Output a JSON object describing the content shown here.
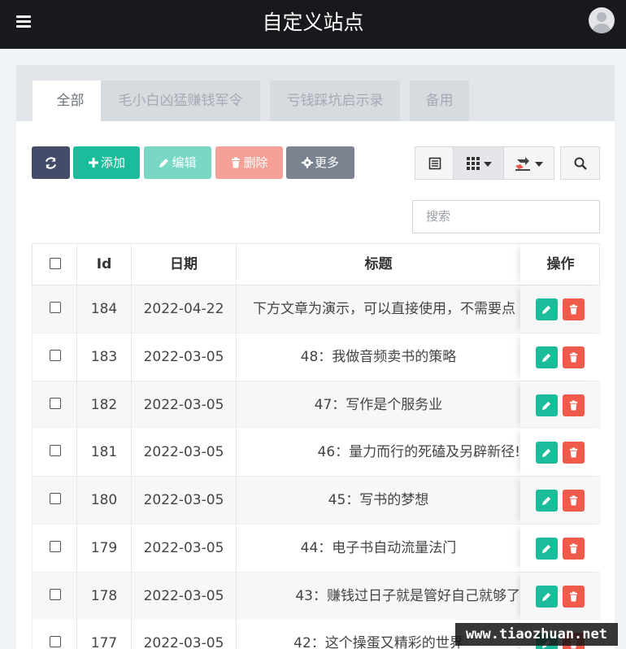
{
  "app": {
    "title": "自定义站点"
  },
  "tabs": [
    {
      "label": "全部",
      "active": true
    },
    {
      "label": "毛小白凶猛赚钱军令",
      "active": false
    },
    {
      "label": "亏钱踩坑启示录",
      "active": false
    },
    {
      "label": "备用",
      "active": false
    }
  ],
  "toolbar": {
    "add_label": "添加",
    "edit_label": "编辑",
    "delete_label": "删除",
    "more_label": "更多"
  },
  "search": {
    "placeholder": "搜索"
  },
  "table": {
    "columns": [
      "Id",
      "日期",
      "标题",
      "操作"
    ],
    "rows": [
      {
        "id": "184",
        "date": "2022-04-22",
        "title": "下方文章为演示，可以直接使用，不需要点"
      },
      {
        "id": "183",
        "date": "2022-03-05",
        "title": "48：我做音频卖书的策略"
      },
      {
        "id": "182",
        "date": "2022-03-05",
        "title": "47：写作是个服务业"
      },
      {
        "id": "181",
        "date": "2022-03-05",
        "title": "46：量力而行的死磕及另辟新径!"
      },
      {
        "id": "180",
        "date": "2022-03-05",
        "title": "45：写书的梦想"
      },
      {
        "id": "179",
        "date": "2022-03-05",
        "title": "44：电子书自动流量法门"
      },
      {
        "id": "178",
        "date": "2022-03-05",
        "title": "43：赚钱过日子就是管好自己就够了"
      },
      {
        "id": "177",
        "date": "2022-03-05",
        "title": "42：这个操蛋又精彩的世界"
      }
    ]
  },
  "watermark": "www.tiaozhuan.net",
  "colors": {
    "header_bg": "#17191c",
    "add": "#1bbc9b",
    "edit": "#78d8c5",
    "delete": "#f5a198",
    "more": "#7c8390",
    "refresh": "#444c69",
    "row_delete": "#f05a4a"
  },
  "icons": {
    "menu": "hamburger-icon",
    "avatar": "user-avatar-icon",
    "refresh": "refresh-icon",
    "add": "plus-icon",
    "edit": "pencil-icon",
    "delete": "trash-icon",
    "more": "gear-icon",
    "view_list": "list-icon",
    "columns": "grid-icon",
    "export": "export-icon",
    "search": "search-icon"
  }
}
